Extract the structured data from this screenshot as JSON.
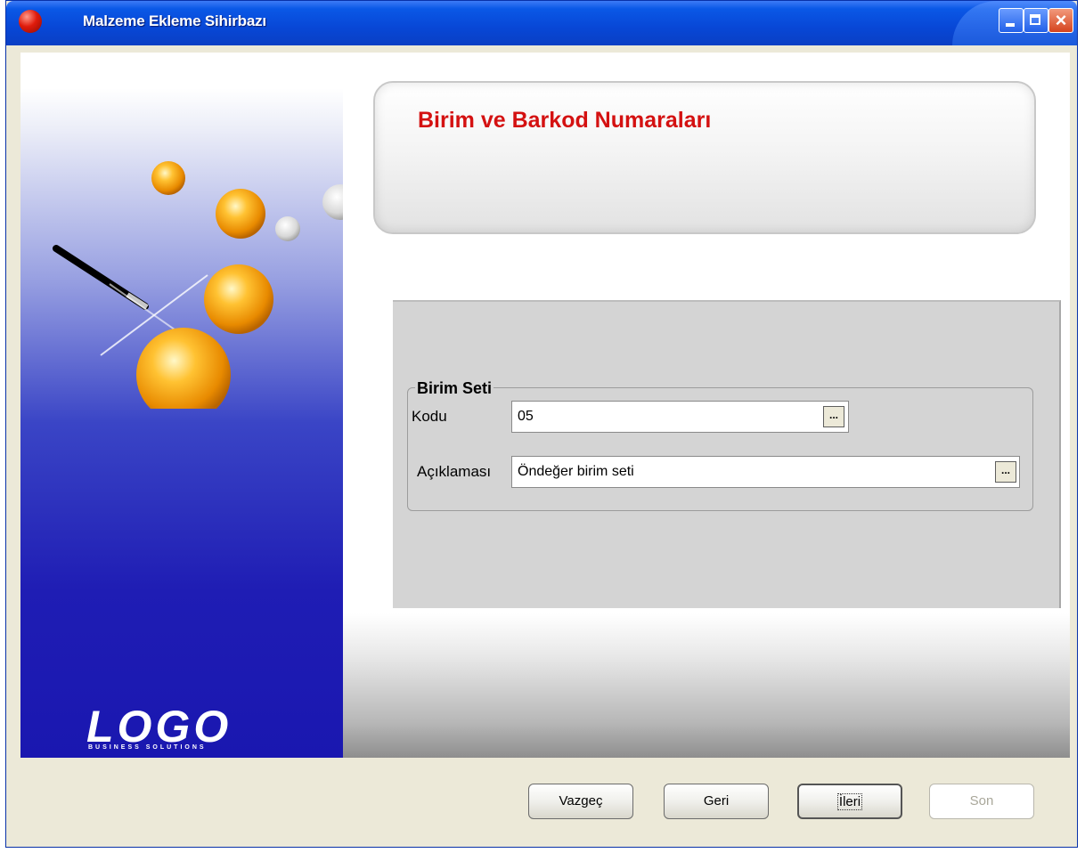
{
  "window": {
    "title": "Malzeme Ekleme Sihirbazı"
  },
  "branding": {
    "logo": "LOGO",
    "tagline": "BUSINESS SOLUTIONS"
  },
  "header": {
    "title": "Birim ve Barkod Numaraları"
  },
  "unit_set": {
    "legend": "Birim Seti",
    "code_label": "Kodu",
    "code_value": "05",
    "description_label": "Açıklaması",
    "description_value": "Öndeğer birim seti",
    "lookup_label": "..."
  },
  "buttons": {
    "cancel": "Vazgeç",
    "back": "Geri",
    "next": "İleri",
    "finish": "Son"
  },
  "colors": {
    "title_red": "#d41111",
    "titlebar_blue": "#0a58e6",
    "side_panel_blue": "#1f1db4"
  }
}
